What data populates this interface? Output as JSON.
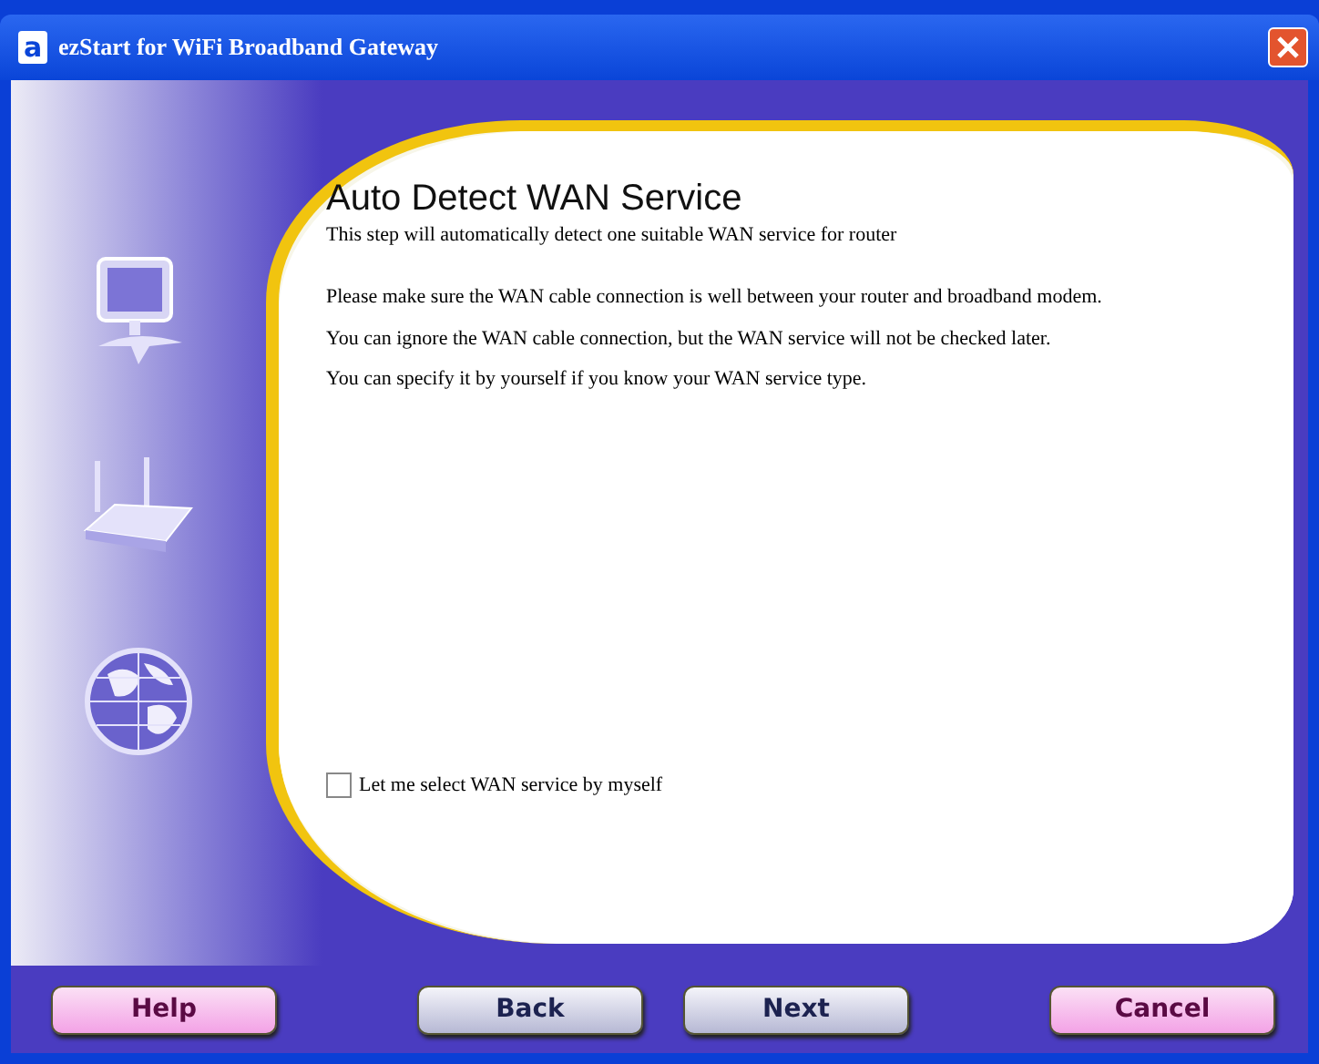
{
  "window": {
    "title": "ezStart for WiFi Broadband Gateway",
    "logo": "a"
  },
  "page": {
    "heading": "Auto Detect WAN Service",
    "subtitle": "This step will automatically detect one suitable WAN service for router",
    "paragraphs": [
      "Please make sure the WAN cable connection is well between your router and broadband modem.",
      "You can ignore the WAN cable connection, but the WAN service will not be checked later.",
      "You can specify it by yourself if you know your WAN service type."
    ],
    "option": {
      "label": "Let me select WAN service by myself",
      "checked": false
    }
  },
  "buttons": [
    {
      "label": "Help",
      "kind": "pink"
    },
    {
      "label": "Back",
      "kind": "grey"
    },
    {
      "label": "Next",
      "kind": "grey"
    },
    {
      "label": "Cancel",
      "kind": "pink"
    }
  ]
}
